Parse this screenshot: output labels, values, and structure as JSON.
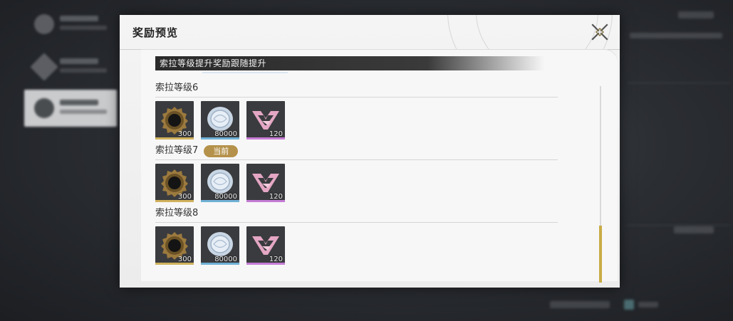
{
  "modal": {
    "title": "奖励预览",
    "close_icon": "close-x-icon"
  },
  "banner": {
    "text": "索拉等级提升奖励跟随提升"
  },
  "levels": [
    {
      "label": "索拉等级6",
      "current": false,
      "items": [
        {
          "icon": "bronze-gear-ring-icon",
          "qty": "300",
          "rarity": "gold"
        },
        {
          "icon": "silver-coin-icon",
          "qty": "80000",
          "rarity": "blue"
        },
        {
          "icon": "pink-crystal-emblem-icon",
          "qty": "120",
          "rarity": "purple"
        }
      ]
    },
    {
      "label": "索拉等级7",
      "current": true,
      "badge": "当前",
      "items": [
        {
          "icon": "bronze-gear-ring-icon",
          "qty": "300",
          "rarity": "gold"
        },
        {
          "icon": "silver-coin-icon",
          "qty": "80000",
          "rarity": "blue"
        },
        {
          "icon": "pink-crystal-emblem-icon",
          "qty": "120",
          "rarity": "purple"
        }
      ]
    },
    {
      "label": "索拉等级8",
      "current": false,
      "items": [
        {
          "icon": "bronze-gear-ring-icon",
          "qty": "300",
          "rarity": "gold"
        },
        {
          "icon": "silver-coin-icon",
          "qty": "80000",
          "rarity": "blue"
        },
        {
          "icon": "pink-crystal-emblem-icon",
          "qty": "120",
          "rarity": "purple"
        }
      ]
    }
  ],
  "colors": {
    "badge": "#b5924b",
    "scrollbar_thumb": "#c9ac46",
    "rarity_gold": "#d1b25c",
    "rarity_blue": "#6fb1d6",
    "rarity_purple": "#c67cd6"
  }
}
